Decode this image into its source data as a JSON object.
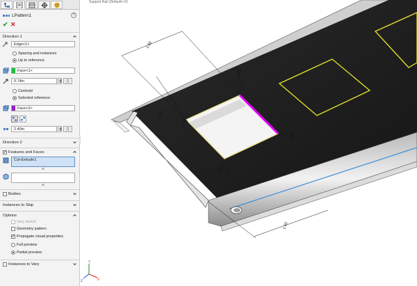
{
  "panel": {
    "title": "LPattern1",
    "help": "?",
    "ok": "✔",
    "cancel": "✕",
    "tabs": [
      "feature-manager-icon",
      "property-manager-icon",
      "configuration-manager-icon",
      "dimxpert-icon",
      "display-manager-icon"
    ],
    "direction1": {
      "header": "Direction 1",
      "edge": "Edge<1>",
      "spacing_label": "Spacing and instances",
      "upto_label": "Up to reference",
      "upto_selected": true,
      "face1": "Face<1>",
      "face1_color": "#17c23a",
      "offset": "0.74in",
      "centroid_label": "Centroid",
      "selref_label": "Selected reference",
      "selref_selected": true,
      "face2": "Face<2>",
      "face2_color": "#9a1dc9",
      "spacing": "2.40in"
    },
    "direction2": {
      "header": "Direction 2"
    },
    "features": {
      "header": "Features and Faces",
      "checked": true,
      "item": "Cut-Extrude1"
    },
    "bodies": {
      "header": "Bodies",
      "checked": false
    },
    "instances_skip": {
      "header": "Instances to Skip"
    },
    "options": {
      "header": "Options",
      "vary_sketch": "Vary sketch",
      "geometry_pattern": "Geometry pattern",
      "propagate": "Propagate visual properties",
      "propagate_checked": true,
      "full_preview": "Full preview",
      "partial_preview": "Partial preview",
      "partial_selected": true
    },
    "instances_vary": {
      "header": "Instances to Vary",
      "checked": false
    }
  },
  "viewport": {
    "breadcrumb": "Support Rail (Default<<D",
    "dimensions": [
      "1.50",
      "0.15",
      "0.15",
      "0.15",
      "0.15",
      "1.00",
      "0.15",
      "1.50"
    ],
    "highlight_colors": {
      "edge": "#e800ff",
      "preview": "#e6e62a"
    }
  }
}
